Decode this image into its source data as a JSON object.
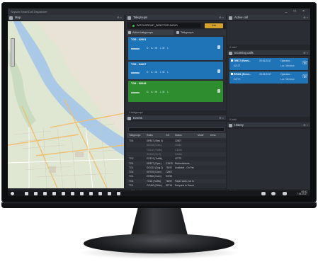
{
  "window": {
    "title": "Sepura SmartCall Dispatcher",
    "controls": "_ □ ×"
  },
  "panels": {
    "map": "Map",
    "talkgroups": "Talkgroups",
    "events": "Events",
    "active_call": "Active call",
    "incoming_calls": "Incoming calls",
    "history": "History"
  },
  "talkgroup_select": {
    "value": "PATCHGROUP_DIRECTOR AUDIO",
    "button": "Join"
  },
  "tabs": {
    "active": "Active talkgroups",
    "all": "Talkgroups"
  },
  "talkgroups": [
    {
      "name": "TG9 - 62001",
      "controls": "D  A/M  LM  L",
      "color": "#1f73b7"
    },
    {
      "name": "TG9 - 64407",
      "controls": "D  A/M  LM  L",
      "color": "#1f73b7"
    },
    {
      "name": "TG4 - 60048",
      "controls": "D  A/M  LM  L",
      "color": "#2d8d2f"
    }
  ],
  "talkgroups_footer": "3 talkgroups",
  "calls": [
    {
      "id": "TR877 (Eveni...",
      "time": "29.06.2017",
      "caller": "Operator...",
      "sub": "62137",
      "location": "Loc. Windsor"
    },
    {
      "id": "RR461 (Eveni...",
      "time": "23.06.2017",
      "caller": "Operator...",
      "sub": "94770",
      "location": "Loc. Windsor"
    }
  ],
  "active_footer": "0 hold",
  "calls_footer": "0 hold",
  "events": {
    "columns": [
      "Talkgroups",
      "Radio",
      "GS",
      "Status",
      "Mode",
      "Desc"
    ],
    "rows": [
      {
        "tg": "TG4",
        "radio": "DR517 (Step 3)",
        "gs": "",
        "status": "12807",
        "dim": false
      },
      {
        "tg": "",
        "radio": "SKS34 (Conv)",
        "gs": "",
        "status": "13343",
        "dim": true
      },
      {
        "tg": "",
        "radio": "TO416 (Traffic)",
        "gs": "",
        "status": "C3456",
        "dim": true
      },
      {
        "tg": "",
        "radio": "RS318 (Op 3)",
        "gs": "",
        "status": "C3456",
        "dim": true
      },
      {
        "tg": "TG2",
        "radio": "PC874 (Traffic)",
        "gs": "",
        "status": "42779",
        "dim": false
      },
      {
        "tg": "TG4",
        "radio": "DR877 (Oper)",
        "gs": "C3478",
        "status": "Refreshments",
        "dim": false
      },
      {
        "tg": "TG1",
        "radio": "DOG22 (Dog 2)",
        "gs": "75197",
        "status": "Available - On Pat",
        "dim": false
      },
      {
        "tg": "TG4",
        "radio": "KR749 (Conv)",
        "gs": "72807",
        "status": "",
        "dim": false
      },
      {
        "tg": "TG1",
        "radio": "ER836 (Conv)",
        "gs": "94752",
        "status": "",
        "dim": false
      },
      {
        "tg": "TG4",
        "radio": "TO16 (Traffic)",
        "gs": "78297",
        "status": "Paper work, not in",
        "dim": false
      },
      {
        "tg": "TG1",
        "radio": "CO460 (Other)",
        "gs": "82716",
        "status": "Respond to Scene",
        "dim": false
      }
    ],
    "footer": "396 events"
  },
  "history_footer": "0 hold",
  "taskbar": {
    "time": "09:52",
    "date": "7.06.2017"
  }
}
